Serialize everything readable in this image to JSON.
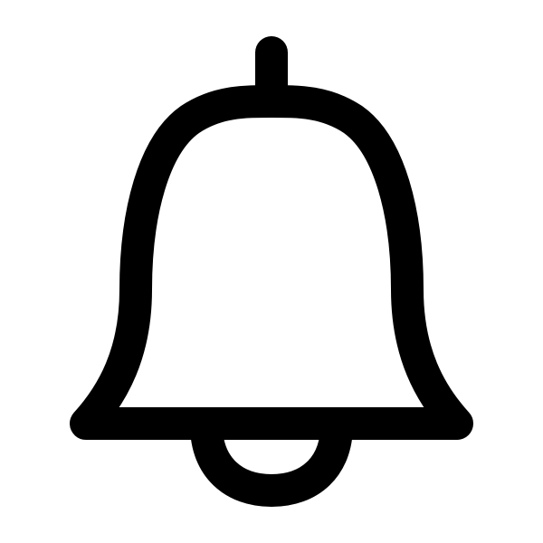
{
  "icon": {
    "name": "bell-icon",
    "stroke_color": "#000000",
    "background_color": "#ffffff"
  }
}
